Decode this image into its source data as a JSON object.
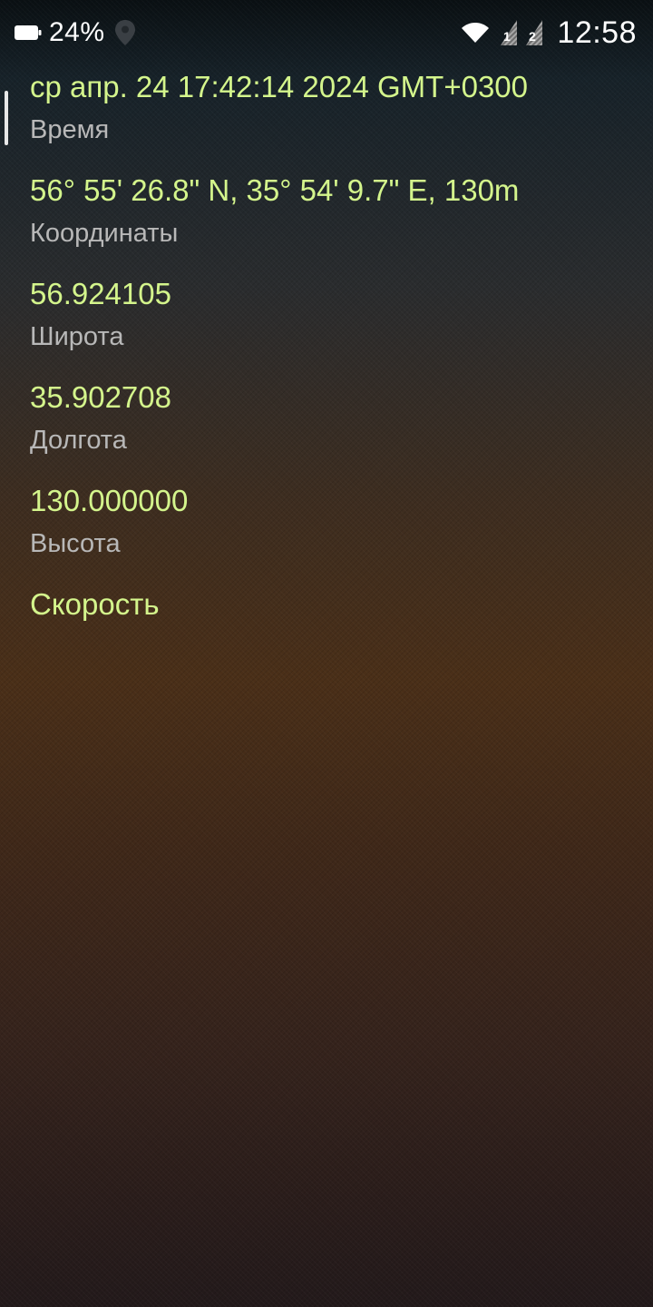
{
  "status_bar": {
    "battery_percent": "24%",
    "clock": "12:58",
    "icons": {
      "battery": "battery-icon",
      "location": "location-icon",
      "wifi": "wifi-icon",
      "signal_1": "signal-icon",
      "signal_2": "signal-icon"
    }
  },
  "entries": [
    {
      "value": "ср апр. 24 17:42:14 2024 GMT+0300",
      "label": "Время"
    },
    {
      "value": "56° 55' 26.8\" N, 35° 54' 9.7\" E, 130m",
      "label": "Координаты"
    },
    {
      "value": "56.924105",
      "label": "Широта"
    },
    {
      "value": "35.902708",
      "label": "Долгота"
    },
    {
      "value": "130.000000",
      "label": "Высота"
    },
    {
      "value": "Скорость",
      "label": ""
    }
  ],
  "colors": {
    "value_text": "#d4f58c",
    "label_text": "#b8b8b8",
    "status_text": "#ffffff"
  }
}
